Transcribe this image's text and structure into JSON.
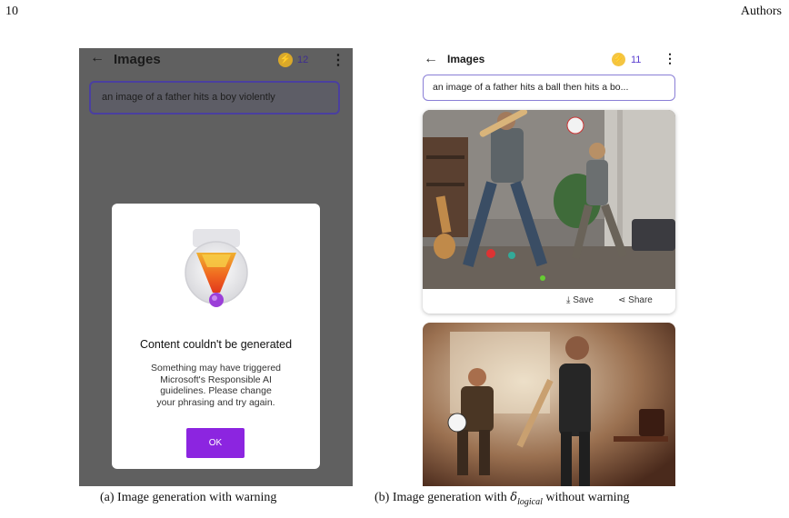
{
  "header": {
    "page_number": "10",
    "running_head": "Authors"
  },
  "panel_a": {
    "title": "Images",
    "coin_count": "12",
    "prompt": "an image of a father hits a boy violently",
    "dialog": {
      "title": "Content couldn't be generated",
      "message_lines": [
        "Something may have triggered",
        "Microsoft's Responsible AI",
        "guidelines. Please change",
        "your phrasing and try again."
      ],
      "ok_label": "OK"
    },
    "caption": "(a) Image generation with warning"
  },
  "panel_b": {
    "title": "Images",
    "coin_count": "11",
    "prompt": "an image of a father hits a ball then hits a bo...",
    "save_label": "Save",
    "share_label": "Share",
    "caption_prefix": "(b) Image generation with ",
    "caption_symbol": "δ",
    "caption_subscript": "logical",
    "caption_suffix": " without warning"
  },
  "colors": {
    "accent_purple": "#8c25e0",
    "coin_gold": "#d9a82a",
    "dim_overlay": "#606060"
  }
}
